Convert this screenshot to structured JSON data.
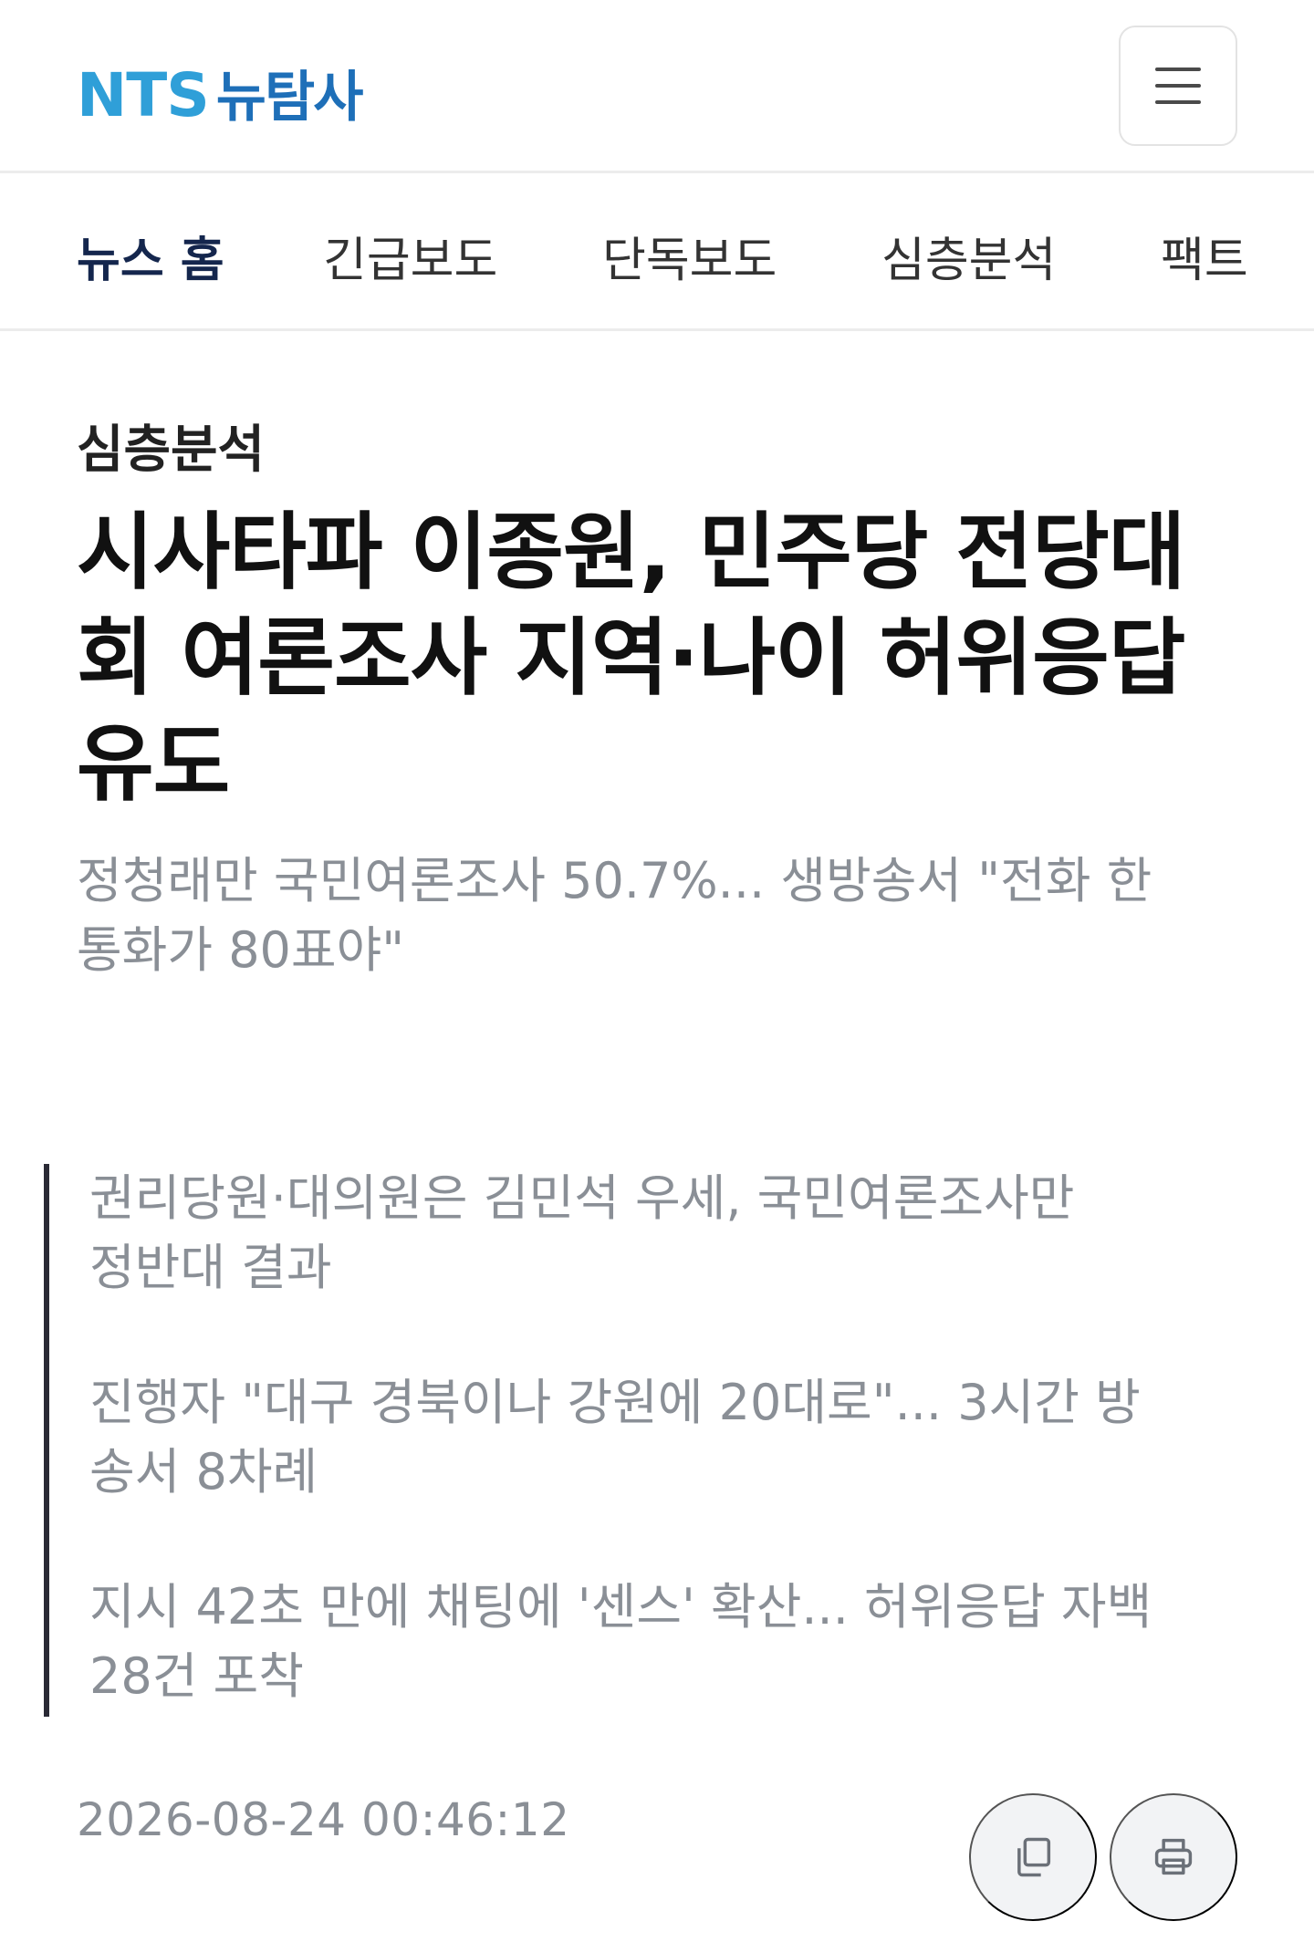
{
  "brand": {
    "logo_en": "NTS",
    "logo_kr": "뉴탐사"
  },
  "header": {
    "menu_icon": "hamburger-menu-icon"
  },
  "nav": {
    "tabs": [
      {
        "label": "뉴스 홈",
        "active": true
      },
      {
        "label": "긴급보도",
        "active": false
      },
      {
        "label": "단독보도",
        "active": false
      },
      {
        "label": "심층분석",
        "active": false
      },
      {
        "label": "팩트",
        "active": false
      }
    ]
  },
  "article": {
    "category": "심층분석",
    "headline_lines": [
      "시사타파 이종원, 민주당 전당대",
      "회 여론조사 지역·나이 허위응답",
      "유도"
    ],
    "subtitle_lines": [
      "정청래만 국민여론조사 50.7%... 생방송서 \"전화 한",
      "통화가 80표야\""
    ],
    "summary": [
      {
        "lines": [
          "권리당원·대의원은 김민석 우세, 국민여론조사만",
          "정반대 결과"
        ]
      },
      {
        "lines": [
          "진행자 \"대구 경북이나 강원에 20대로\"... 3시간 방",
          "송서 8차례"
        ]
      },
      {
        "lines": [
          "지시 42초 만에 채팅에 '센스' 확산... 허위응답 자백",
          "28건 포착"
        ]
      }
    ],
    "timestamp": "2026-08-24 00:46:12"
  },
  "actions": {
    "copy_icon": "copy-icon",
    "print_icon": "print-icon"
  },
  "colors": {
    "logo_accent": "#2f9fd8",
    "logo_kr": "#1e6fb8",
    "nav_active": "#14264d",
    "muted_text": "#8a8f96"
  }
}
